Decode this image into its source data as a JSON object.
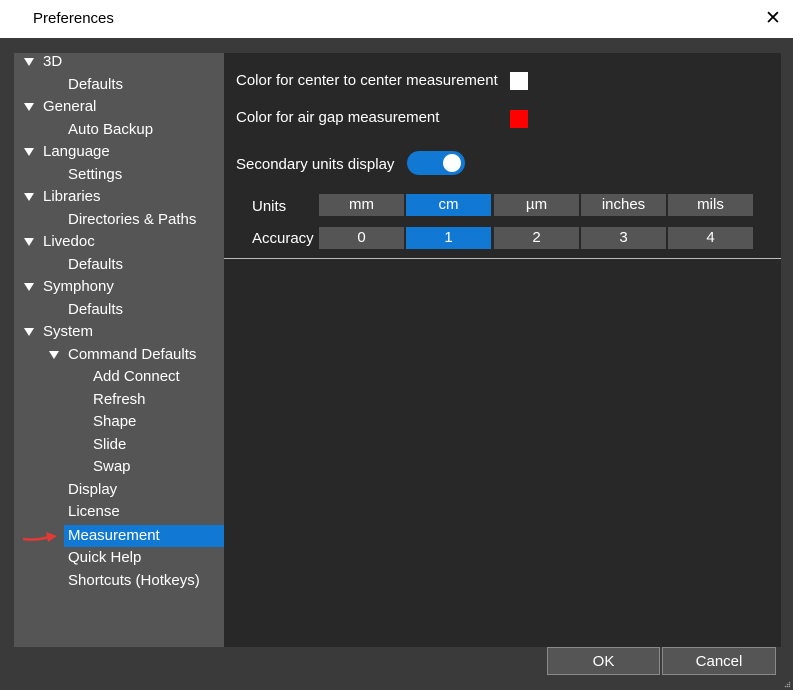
{
  "window": {
    "title": "Preferences",
    "close_glyph": "✕"
  },
  "tree": [
    {
      "label": "3D",
      "expanded": true,
      "level": 0
    },
    {
      "label": "Defaults",
      "level": 1
    },
    {
      "label": "General",
      "expanded": true,
      "level": 0
    },
    {
      "label": "Auto Backup",
      "level": 1
    },
    {
      "label": "Language",
      "expanded": true,
      "level": 0
    },
    {
      "label": "Settings",
      "level": 1
    },
    {
      "label": "Libraries",
      "expanded": true,
      "level": 0
    },
    {
      "label": "Directories & Paths",
      "level": 1
    },
    {
      "label": "Livedoc",
      "expanded": true,
      "level": 0
    },
    {
      "label": "Defaults",
      "level": 1
    },
    {
      "label": "Symphony",
      "expanded": true,
      "level": 0
    },
    {
      "label": "Defaults",
      "level": 1
    },
    {
      "label": "System",
      "expanded": true,
      "level": 0
    },
    {
      "label": "Command Defaults",
      "expanded": true,
      "level": 1
    },
    {
      "label": "Add Connect",
      "level": 2
    },
    {
      "label": "Refresh",
      "level": 2
    },
    {
      "label": "Shape",
      "level": 2
    },
    {
      "label": "Slide",
      "level": 2
    },
    {
      "label": "Swap",
      "level": 2
    },
    {
      "label": "Display",
      "level": 1
    },
    {
      "label": "License",
      "level": 1
    },
    {
      "label": "Measurement",
      "level": 1,
      "selected": true
    },
    {
      "label": "Quick Help",
      "level": 1
    },
    {
      "label": "Shortcuts (Hotkeys)",
      "level": 1
    }
  ],
  "measurement": {
    "center_label": "Color for center to center measurement",
    "center_color": "#ffffff",
    "airgap_label": "Color for air gap measurement",
    "airgap_color": "#ff0000",
    "secondary_label": "Secondary units display",
    "secondary_on": true,
    "units_label": "Units",
    "units": [
      "mm",
      "cm",
      "µm",
      "inches",
      "mils"
    ],
    "units_selected": "cm",
    "accuracy_label": "Accuracy",
    "accuracy": [
      "0",
      "1",
      "2",
      "3",
      "4"
    ],
    "accuracy_selected": "1"
  },
  "buttons": {
    "ok": "OK",
    "cancel": "Cancel"
  },
  "colors": {
    "accent": "#1179d4",
    "annotation_arrow": "#e53935"
  }
}
